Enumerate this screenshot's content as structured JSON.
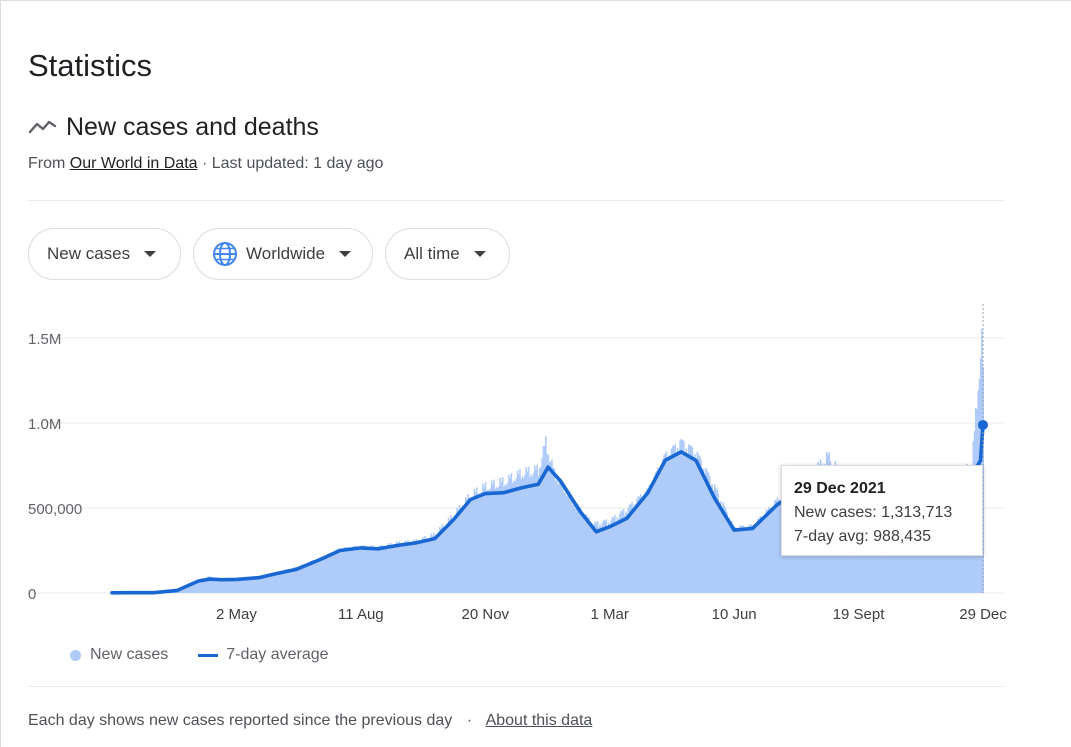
{
  "page": {
    "title": "Statistics"
  },
  "section": {
    "title": "New cases and deaths",
    "icon": "trending-icon",
    "source_prefix": "From",
    "source_link": "Our World in Data",
    "source_suffix": "· Last updated: 1 day ago"
  },
  "filters": [
    {
      "label": "New cases",
      "icon": "chevron-down-icon"
    },
    {
      "label": "Worldwide",
      "icon": "globe-icon"
    },
    {
      "label": "All time",
      "icon": "chevron-down-icon"
    }
  ],
  "tooltip": {
    "date": "29 Dec 2021",
    "cases_line": "New cases: 1,313,713",
    "avg_line": "7-day avg: 988,435"
  },
  "footer": {
    "note": "Each day shows new cases reported since the previous day",
    "separator": "·",
    "about_link": "About this data"
  },
  "colors": {
    "bars": "#aecbfa",
    "line": "#1967d2",
    "grid": "#ebebeb"
  },
  "chart_data": {
    "type": "bar",
    "x_start": "2020-01-22",
    "x_end": "2021-12-29",
    "ylim": [
      0,
      1500000
    ],
    "y_ticks": [
      {
        "value": 0,
        "label": "0"
      },
      {
        "value": 500000,
        "label": "500,000"
      },
      {
        "value": 1000000,
        "label": "1.0M"
      },
      {
        "value": 1500000,
        "label": "1.5M"
      }
    ],
    "x_ticks": [
      {
        "date": "2020-05-02",
        "label": "2 May"
      },
      {
        "date": "2020-08-11",
        "label": "11 Aug"
      },
      {
        "date": "2020-11-20",
        "label": "20 Nov"
      },
      {
        "date": "2021-03-01",
        "label": "1 Mar"
      },
      {
        "date": "2021-06-10",
        "label": "10 Jun"
      },
      {
        "date": "2021-09-19",
        "label": "19 Sept"
      },
      {
        "date": "2021-12-29",
        "label": "29 Dec"
      }
    ],
    "series": [
      {
        "name": "New cases",
        "mark": "bar",
        "note": "daily values (approx.)",
        "points": [
          [
            "2020-01-22",
            5000
          ],
          [
            "2020-02-10",
            9000
          ],
          [
            "2020-03-01",
            7000
          ],
          [
            "2020-03-15",
            20000
          ],
          [
            "2020-04-01",
            78000
          ],
          [
            "2020-04-10",
            95000
          ],
          [
            "2020-04-20",
            80000
          ],
          [
            "2020-05-02",
            82000
          ],
          [
            "2020-05-20",
            95000
          ],
          [
            "2020-06-01",
            115000
          ],
          [
            "2020-06-20",
            150000
          ],
          [
            "2020-07-10",
            205000
          ],
          [
            "2020-07-25",
            255000
          ],
          [
            "2020-08-11",
            270000
          ],
          [
            "2020-08-25",
            265000
          ],
          [
            "2020-09-10",
            290000
          ],
          [
            "2020-09-25",
            300000
          ],
          [
            "2020-10-10",
            340000
          ],
          [
            "2020-10-25",
            450000
          ],
          [
            "2020-11-08",
            570000
          ],
          [
            "2020-11-20",
            620000
          ],
          [
            "2020-12-05",
            650000
          ],
          [
            "2020-12-20",
            700000
          ],
          [
            "2021-01-02",
            720000
          ],
          [
            "2021-01-08",
            880000
          ],
          [
            "2021-01-15",
            700000
          ],
          [
            "2021-02-01",
            520000
          ],
          [
            "2021-02-15",
            400000
          ],
          [
            "2021-03-01",
            420000
          ],
          [
            "2021-03-15",
            490000
          ],
          [
            "2021-04-01",
            600000
          ],
          [
            "2021-04-15",
            800000
          ],
          [
            "2021-04-28",
            880000
          ],
          [
            "2021-05-10",
            820000
          ],
          [
            "2021-05-25",
            620000
          ],
          [
            "2021-06-10",
            380000
          ],
          [
            "2021-06-25",
            390000
          ],
          [
            "2021-07-15",
            540000
          ],
          [
            "2021-08-01",
            640000
          ],
          [
            "2021-08-15",
            720000
          ],
          [
            "2021-08-25",
            800000
          ],
          [
            "2021-09-10",
            640000
          ],
          [
            "2021-09-19",
            540000
          ],
          [
            "2021-10-05",
            420000
          ],
          [
            "2021-10-20",
            430000
          ],
          [
            "2021-11-05",
            480000
          ],
          [
            "2021-11-20",
            560000
          ],
          [
            "2021-12-05",
            620000
          ],
          [
            "2021-12-20",
            760000
          ],
          [
            "2021-12-27",
            1400000
          ],
          [
            "2021-12-28",
            1480000
          ],
          [
            "2021-12-29",
            1313713
          ]
        ]
      },
      {
        "name": "7-day average",
        "mark": "line",
        "points": [
          [
            "2020-01-22",
            1000
          ],
          [
            "2020-02-10",
            2000
          ],
          [
            "2020-02-25",
            1500
          ],
          [
            "2020-03-15",
            15000
          ],
          [
            "2020-04-01",
            70000
          ],
          [
            "2020-04-10",
            82000
          ],
          [
            "2020-04-20",
            78000
          ],
          [
            "2020-05-02",
            80000
          ],
          [
            "2020-05-20",
            90000
          ],
          [
            "2020-06-01",
            110000
          ],
          [
            "2020-06-20",
            140000
          ],
          [
            "2020-07-10",
            200000
          ],
          [
            "2020-07-25",
            250000
          ],
          [
            "2020-08-11",
            265000
          ],
          [
            "2020-08-25",
            260000
          ],
          [
            "2020-09-10",
            280000
          ],
          [
            "2020-09-25",
            295000
          ],
          [
            "2020-10-10",
            320000
          ],
          [
            "2020-10-25",
            430000
          ],
          [
            "2020-11-08",
            550000
          ],
          [
            "2020-11-20",
            585000
          ],
          [
            "2020-12-05",
            590000
          ],
          [
            "2020-12-20",
            620000
          ],
          [
            "2021-01-02",
            640000
          ],
          [
            "2021-01-10",
            740000
          ],
          [
            "2021-01-20",
            660000
          ],
          [
            "2021-02-05",
            480000
          ],
          [
            "2021-02-18",
            360000
          ],
          [
            "2021-03-01",
            390000
          ],
          [
            "2021-03-15",
            440000
          ],
          [
            "2021-04-01",
            590000
          ],
          [
            "2021-04-15",
            780000
          ],
          [
            "2021-04-28",
            830000
          ],
          [
            "2021-05-10",
            780000
          ],
          [
            "2021-05-25",
            560000
          ],
          [
            "2021-06-10",
            370000
          ],
          [
            "2021-06-25",
            380000
          ],
          [
            "2021-07-15",
            520000
          ],
          [
            "2021-08-01",
            600000
          ],
          [
            "2021-08-15",
            640000
          ],
          [
            "2021-09-01",
            640000
          ],
          [
            "2021-09-19",
            500000
          ],
          [
            "2021-10-05",
            420000
          ],
          [
            "2021-10-20",
            410000
          ],
          [
            "2021-11-05",
            470000
          ],
          [
            "2021-11-20",
            560000
          ],
          [
            "2021-12-05",
            610000
          ],
          [
            "2021-12-20",
            690000
          ],
          [
            "2021-12-27",
            780000
          ],
          [
            "2021-12-29",
            988435
          ]
        ]
      }
    ],
    "highlight": {
      "date": "2021-12-29",
      "value": 988435
    }
  },
  "legend": [
    {
      "label": "New cases"
    },
    {
      "label": "7-day average"
    }
  ]
}
